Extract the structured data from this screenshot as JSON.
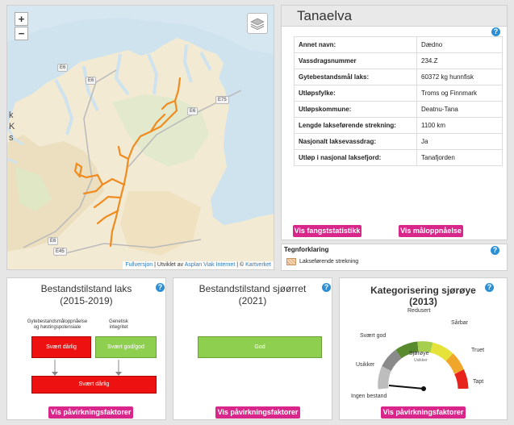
{
  "map": {
    "zoom_in": "+",
    "zoom_out": "−",
    "road_labels": [
      "E6",
      "E6",
      "E75",
      "E6",
      "E6",
      "E45"
    ],
    "edge_labels": [
      "k",
      "K",
      "s"
    ],
    "attribution": {
      "full": "Fullversjon",
      "sep1": " | Utviklet av ",
      "dev": "Asplan Viak Internet",
      "sep2": " | © ",
      "src": "Kartverket"
    }
  },
  "info": {
    "title": "Tanaelva",
    "rows": [
      {
        "key": "Annet navn:",
        "value": "Dædno"
      },
      {
        "key": "Vassdragsnummer",
        "value": "234.Z"
      },
      {
        "key": "Gytebestandsmål laks:",
        "value": "60372 kg hunnfisk"
      },
      {
        "key": "Utløpsfylke:",
        "value": "Troms og Finnmark"
      },
      {
        "key": "Utløpskommune:",
        "value": "Deatnu-Tana"
      },
      {
        "key": "Lengde lakseførende strekning:",
        "value": "1100 km"
      },
      {
        "key": "Nasjonalt laksevassdrag:",
        "value": "Ja"
      },
      {
        "key": "Utløp i nasjonal laksefjord:",
        "value": "Tanafjorden"
      }
    ],
    "btn_fangst": "Vis fangststatistikk",
    "btn_maal": "Vis måloppnåelse"
  },
  "legend": {
    "title": "Tegnforklaring",
    "item": "Lakseførende strekning"
  },
  "laks": {
    "title": "Bestandstilstand laks",
    "period": "(2015-2019)",
    "label_left": "Gytebestandsmåloppnåelse og høstingspotensiale",
    "label_right": "Genetisk integritet",
    "box_left": "Svært dårlig",
    "box_right": "Svært god/god",
    "box_bottom": "Svært dårlig",
    "btn": "Vis påvirkningsfaktorer"
  },
  "sjo": {
    "title": "Bestandstilstand sjøørret",
    "period": "(2021)",
    "box": "God",
    "btn": "Vis påvirkningsfaktorer"
  },
  "kat": {
    "title": "Kategorisering sjørøye",
    "period": "(2013)",
    "gauge_labels": [
      "Ingen bestand",
      "Usikker",
      "Svært god",
      "Redusert",
      "Sårbar",
      "Truet",
      "Tapt"
    ],
    "center_label": "Sjørøye",
    "center_sub": "Usikker",
    "btn": "Vis påvirkningsfaktorer"
  },
  "help_symbol": "?"
}
